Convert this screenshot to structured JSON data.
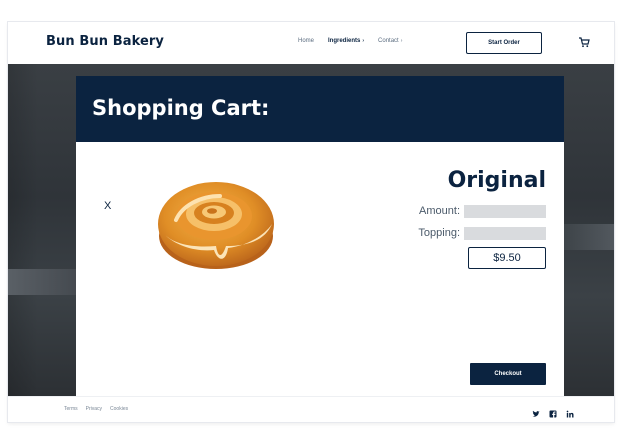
{
  "header": {
    "brand": "Bun Bun Bakery",
    "nav": [
      {
        "label": "Home",
        "caret": ""
      },
      {
        "label": "Ingredients",
        "caret": "›"
      },
      {
        "label": "Contact",
        "caret": "›"
      }
    ],
    "start_order_label": "Start Order",
    "cart_icon": "cart-icon"
  },
  "cart": {
    "title": "Shopping Cart:",
    "remove_label": "X",
    "item": {
      "image": "cinnamon-bun",
      "name": "Original",
      "amount_label": "Amount:",
      "amount_value": "",
      "topping_label": "Topping:",
      "topping_value": "",
      "price": "$9.50"
    },
    "checkout_label": "Checkout"
  },
  "footer": {
    "links": [
      "Terms",
      "Privacy",
      "Cookies"
    ],
    "social": [
      "twitter-icon",
      "facebook-icon",
      "linkedin-icon"
    ]
  },
  "colors": {
    "navy": "#0b2340",
    "field_gray": "#d9dbde",
    "bun_orange": "#d9892a"
  }
}
